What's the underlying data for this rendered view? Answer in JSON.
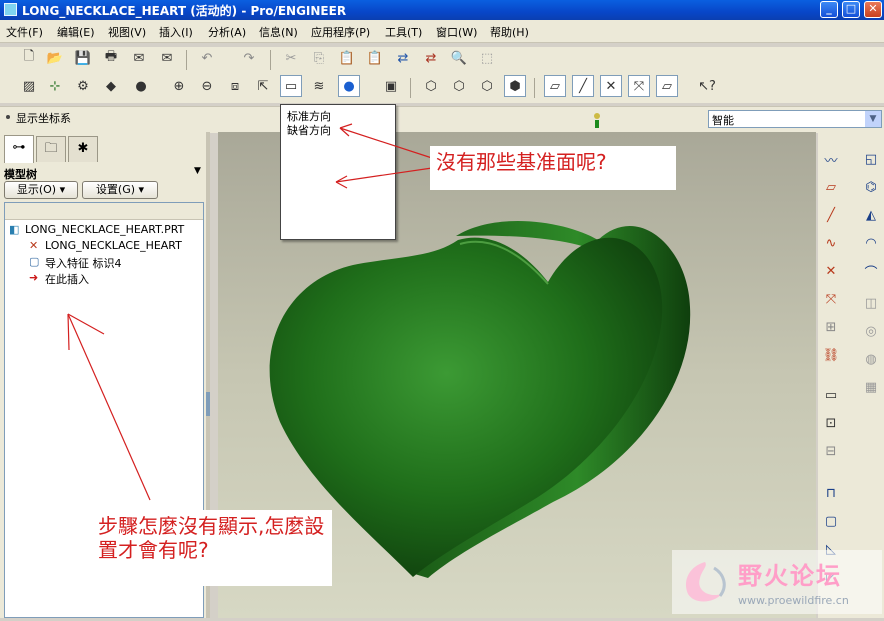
{
  "window": {
    "title": "LONG_NECKLACE_HEART (活动的) - Pro/ENGINEER",
    "minimize": "_",
    "maximize": "□",
    "close": "✕"
  },
  "menu": [
    "文件(F)",
    "编辑(E)",
    "视图(V)",
    "插入(I)",
    "分析(A)",
    "信息(N)",
    "应用程序(P)",
    "工具(T)",
    "窗口(W)",
    "帮助(H)"
  ],
  "statusbar": {
    "display_csys": "显示坐标系",
    "filter_value": "智能"
  },
  "left_panel": {
    "header": "模型树",
    "show_button": "显示(O) ▾",
    "settings_button": "设置(G) ▾",
    "tree": [
      {
        "label": "LONG_NECKLACE_HEART.PRT",
        "icon": "part-icon"
      },
      {
        "label": "LONG_NECKLACE_HEART",
        "icon": "csys-icon"
      },
      {
        "label": "导入特征 标识4",
        "icon": "import-feature-icon"
      },
      {
        "label": "在此插入",
        "icon": "insert-here-arrow-icon"
      }
    ]
  },
  "orientation_dropdown": {
    "items": [
      "标准方向",
      "缺省方向"
    ]
  },
  "annotations": {
    "top": "沒有那些基准面呢?",
    "bottom": "步驟怎麼沒有顯示,怎麼設置才會有呢?"
  },
  "watermark": {
    "title": "野火论坛",
    "url": "www.proewildfire.cn"
  },
  "colors": {
    "model": "#1f6e1a",
    "annotation_text": "#d42020",
    "background_top": "#a9a898",
    "background_bottom": "#d7d8c4"
  }
}
